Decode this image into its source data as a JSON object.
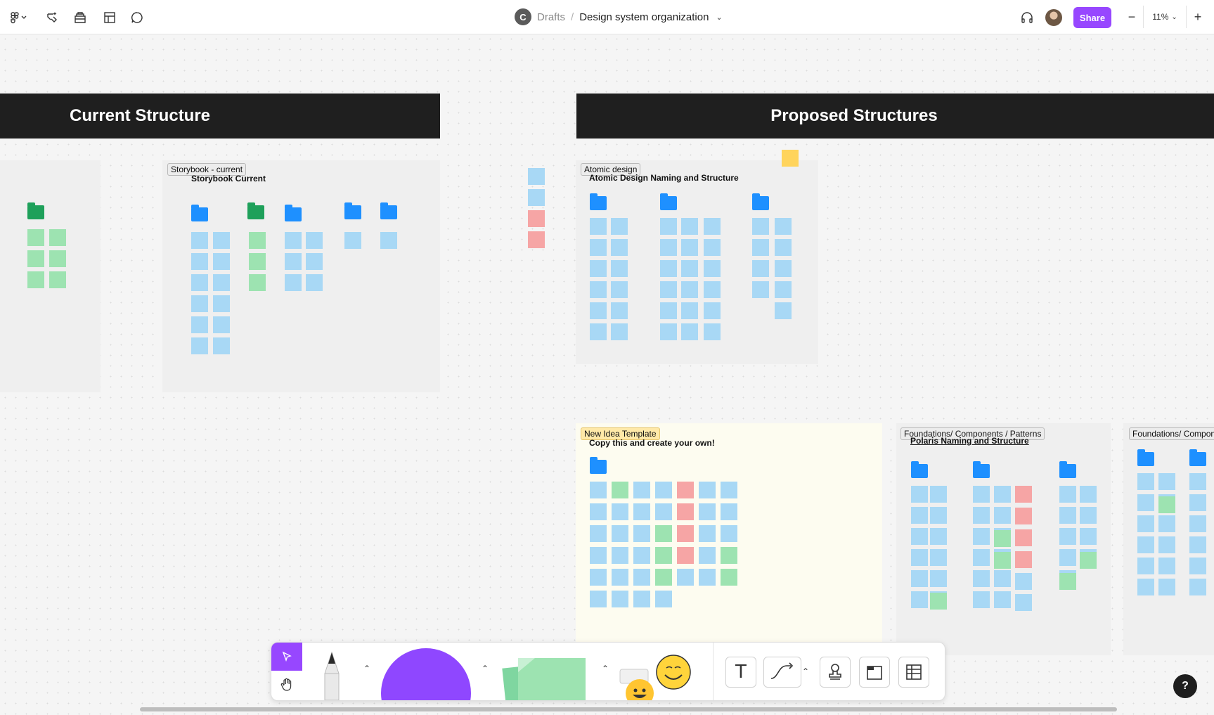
{
  "topbar": {
    "breadcrumb": {
      "avatar_initial": "C",
      "drafts": "Drafts",
      "separator": "/",
      "file_name": "Design system organization"
    },
    "share_label": "Share",
    "zoom": {
      "minus": "−",
      "value": "11%",
      "plus": "+"
    }
  },
  "canvas": {
    "banners": {
      "current": "Current Structure",
      "proposed": "Proposed Structures"
    },
    "sections": {
      "storybook_tag": "Storybook - current",
      "storybook_title": "Storybook Current",
      "atomic_tag": "Atomic design",
      "atomic_title": "Atomic Design Naming and Structure",
      "new_idea_tag": "New Idea Template",
      "new_idea_title": "Copy this and create your own!",
      "fcp_tag": "Foundations/ Components / Patterns",
      "fcp_title": "Polaris Naming and Structure",
      "fcp2_tag": "Foundations/ Compon"
    }
  },
  "toolbar": {
    "tools": [
      "move",
      "hand",
      "pen",
      "shapes",
      "sticky",
      "stamps",
      "text",
      "connector",
      "person",
      "section",
      "table"
    ],
    "text_tool_glyph": "T"
  },
  "help_label": "?",
  "colors": {
    "accent": "#9747ff",
    "banner": "#1f1f1f",
    "sticky_blue": "#a8d8f5",
    "sticky_green": "#9de3b1",
    "sticky_red": "#f6a5a5",
    "folder_blue": "#1e90ff",
    "folder_green": "#1ea05a"
  }
}
